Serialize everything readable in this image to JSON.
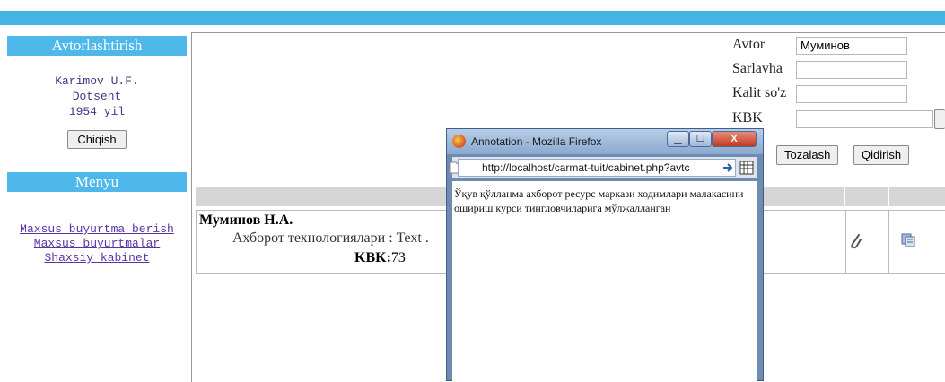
{
  "sidebar": {
    "auth_header": "Avtorlashtirish",
    "user_name": "Karimov U.F.",
    "user_title": "Dotsent",
    "user_year": "1954 yil",
    "exit_button": "Chiqish",
    "menu_header": "Menyu",
    "menu_items": [
      {
        "label": "Maxsus buyurtma berish"
      },
      {
        "label": "Maxsus buyurtmalar"
      },
      {
        "label": "Shaxsiy kabinet"
      }
    ]
  },
  "search": {
    "author_label": "Avtor",
    "author_value": "Муминов",
    "title_label": "Sarlavha",
    "title_value": "",
    "keyword_label": "Kalit so'z",
    "keyword_value": "",
    "kbk_label": "KBK",
    "kbk_value": "",
    "clear_button": "Tozalash",
    "search_button": "Qidirish"
  },
  "results": {
    "rows": [
      {
        "author": "Муминов Н.А.",
        "title": "Ахборот технологиялари : Text .",
        "kbk_label": "KBK:",
        "kbk_value": "73"
      }
    ]
  },
  "popup": {
    "window_title": "Annotation - Mozilla Firefox",
    "url": "http://localhost/carmat-tuit/cabinet.php?avtc",
    "content": "Ўқув қўлланма ахборот ресурс маркази ходимлари малакасини ошириш курси тингловчиларига мўлжалланган"
  },
  "colors": {
    "top_bar": "#43b5e3",
    "section_header": "#4fb7ea",
    "link": "#5a33a6"
  },
  "icons": [
    "paperclip-icon",
    "copy-icon",
    "firefox-icon",
    "page-icon",
    "go-arrow-icon",
    "grid-icon",
    "minimize-icon",
    "maximize-icon",
    "close-icon"
  ]
}
